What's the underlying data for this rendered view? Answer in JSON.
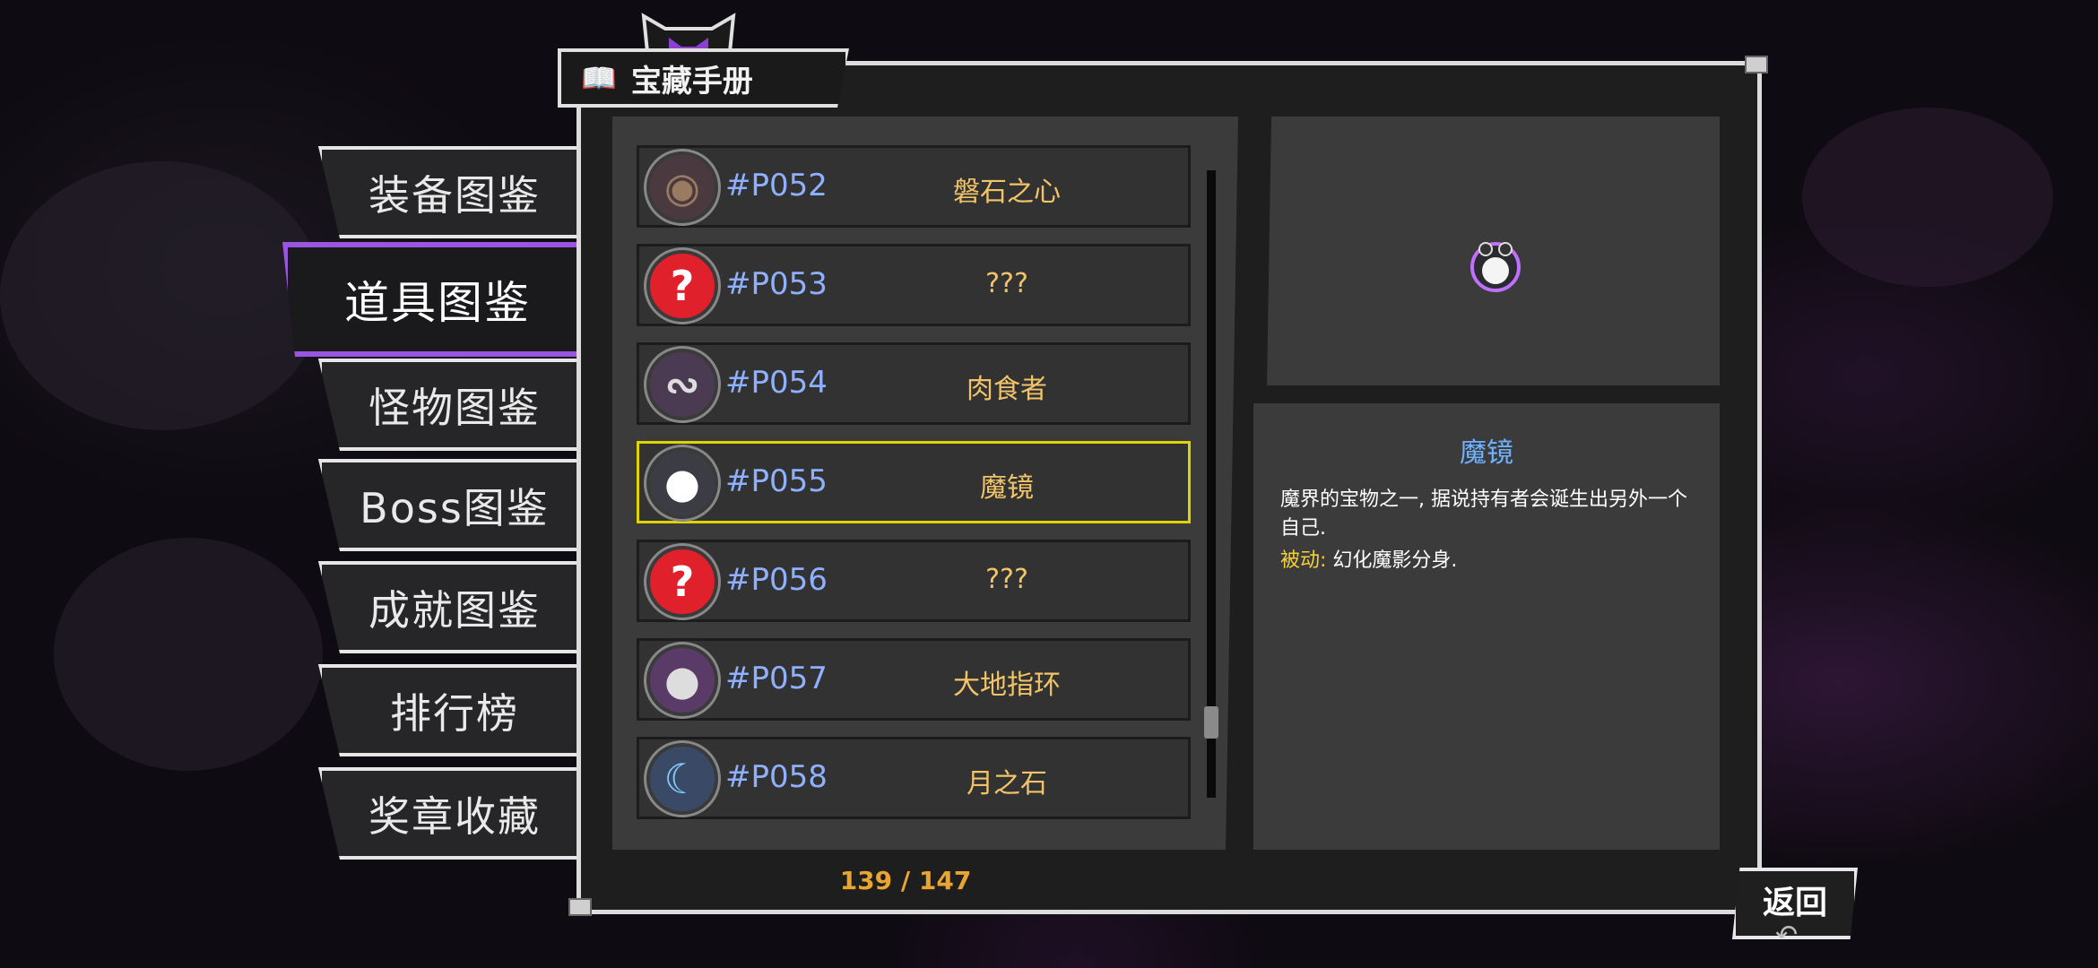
{
  "title": "宝藏手册",
  "tabs": [
    {
      "label": "装备图鉴"
    },
    {
      "label": "道具图鉴",
      "active": true
    },
    {
      "label": "怪物图鉴"
    },
    {
      "label": "Boss图鉴"
    },
    {
      "label": "成就图鉴"
    },
    {
      "label": "排行榜"
    },
    {
      "label": "奖章收藏"
    }
  ],
  "items": [
    {
      "code": "#P052",
      "name": "磐石之心",
      "icon": "rock-heart-icon"
    },
    {
      "code": "#P053",
      "name": "???",
      "icon": "unknown-question-icon"
    },
    {
      "code": "#P054",
      "name": "肉食者",
      "icon": "bone-serpent-icon"
    },
    {
      "code": "#P055",
      "name": "魔镜",
      "icon": "magic-mirror-icon",
      "selected": true
    },
    {
      "code": "#P056",
      "name": "???",
      "icon": "unknown-question-icon"
    },
    {
      "code": "#P057",
      "name": "大地指环",
      "icon": "earth-ring-icon"
    },
    {
      "code": "#P058",
      "name": "月之石",
      "icon": "moonstone-icon"
    }
  ],
  "counter": "139 / 147",
  "detail": {
    "name": "魔镜",
    "description": "魔界的宝物之一, 据说持有者会诞生出另外一个自己.",
    "passive_label": "被动:",
    "passive_text": " 幻化魔影分身."
  },
  "back_label": "返回",
  "colors": {
    "accent_purple": "#9a55e0",
    "code_blue": "#8fb0ff",
    "name_gold": "#f2c46a",
    "selected_border": "#e0d400",
    "detail_title": "#6fb1ff",
    "passive_yellow": "#f5d23a"
  }
}
